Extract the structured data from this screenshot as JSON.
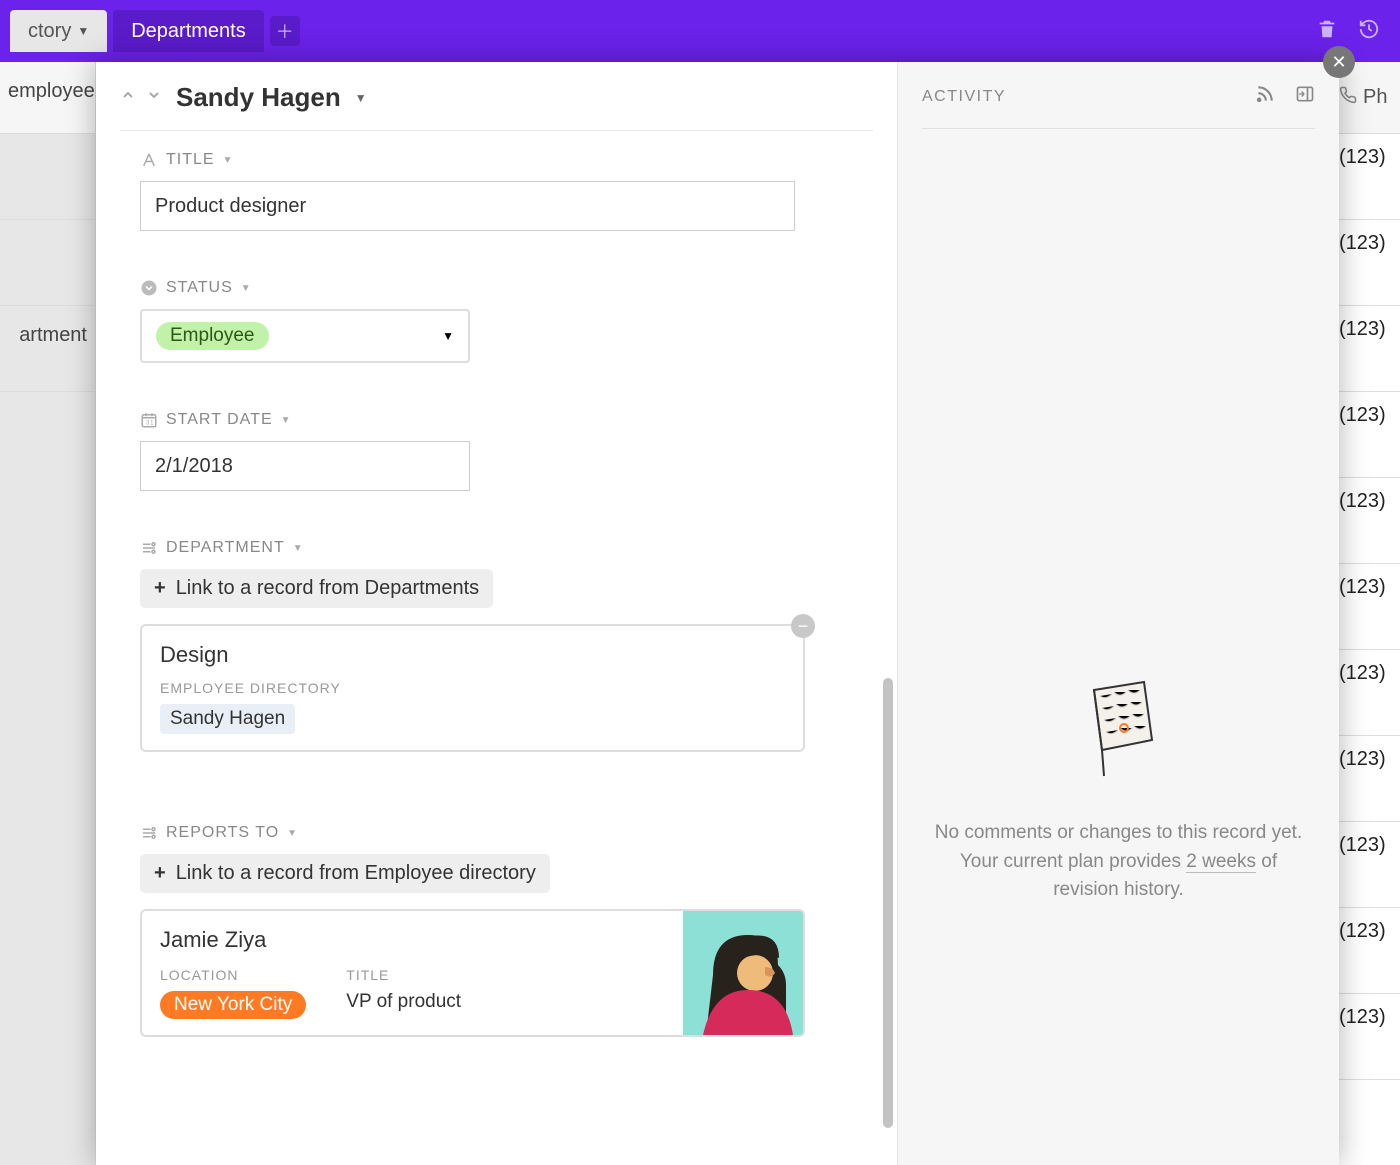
{
  "topbar": {
    "tab1": "ctory",
    "tab2": "Departments"
  },
  "bg": {
    "left_header": "employee",
    "left_row3": "artment",
    "right_header": "Ph",
    "phone": "(123)"
  },
  "record": {
    "name": "Sandy Hagen",
    "fields": {
      "title_label": "TITLE",
      "title_value": "Product designer",
      "status_label": "STATUS",
      "status_value": "Employee",
      "startdate_label": "START DATE",
      "startdate_value": "2/1/2018",
      "department_label": "DEPARTMENT",
      "department_link_add": "Link to a record from Departments",
      "department_card_title": "Design",
      "department_card_sublabel": "EMPLOYEE DIRECTORY",
      "department_card_chip": "Sandy Hagen",
      "reports_label": "REPORTS TO",
      "reports_link_add": "Link to a record from Employee directory",
      "reports_name": "Jamie Ziya",
      "reports_loc_label": "LOCATION",
      "reports_loc_value": "New York City",
      "reports_title_label": "TITLE",
      "reports_title_value": "VP of product"
    }
  },
  "activity": {
    "heading": "ACTIVITY",
    "empty1": "No comments or changes to this record yet. Your current plan provides",
    "empty_underlined": "2 weeks",
    "empty2": "of revision history."
  }
}
